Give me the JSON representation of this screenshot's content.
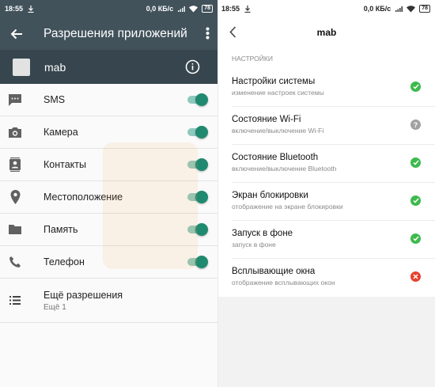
{
  "left": {
    "status_time": "18:55",
    "status_net": "0,0 КБ/с",
    "status_battery": "78",
    "title": "Разрешения приложений",
    "app_name": "mab",
    "permissions": [
      {
        "label": "SMS",
        "icon": "sms-icon",
        "enabled": true
      },
      {
        "label": "Камера",
        "icon": "camera-icon",
        "enabled": true
      },
      {
        "label": "Контакты",
        "icon": "contacts-icon",
        "enabled": true
      },
      {
        "label": "Местоположение",
        "icon": "location-icon",
        "enabled": true
      },
      {
        "label": "Память",
        "icon": "folder-icon",
        "enabled": true
      },
      {
        "label": "Телефон",
        "icon": "phone-icon",
        "enabled": true
      }
    ],
    "more": {
      "label": "Ещё разрешения",
      "sub": "Ещё 1"
    }
  },
  "right": {
    "status_time": "18:55",
    "status_net": "0,0 КБ/с",
    "status_battery": "78",
    "title": "mab",
    "section": "НАСТРОЙКИ",
    "settings": [
      {
        "title": "Настройки системы",
        "sub": "изменение настроек системы",
        "status": "allowed"
      },
      {
        "title": "Состояние Wi-Fi",
        "sub": "включение/выключение Wi-Fi",
        "status": "ask"
      },
      {
        "title": "Состояние Bluetooth",
        "sub": "включение/выключение Bluetooth",
        "status": "allowed"
      },
      {
        "title": "Экран блокировки",
        "sub": "отображение на экране блокировки",
        "status": "allowed"
      },
      {
        "title": "Запуск в фоне",
        "sub": "запуск в фоне",
        "status": "allowed"
      },
      {
        "title": "Всплывающие окна",
        "sub": "отображение всплывающих окон",
        "status": "denied"
      }
    ]
  },
  "colors": {
    "toolbar": "#41525b",
    "app_row": "#37464e",
    "switch_on": "#1f8a70",
    "allowed": "#3dba4d",
    "ask": "#a1a1a1",
    "denied": "#e8412f"
  }
}
